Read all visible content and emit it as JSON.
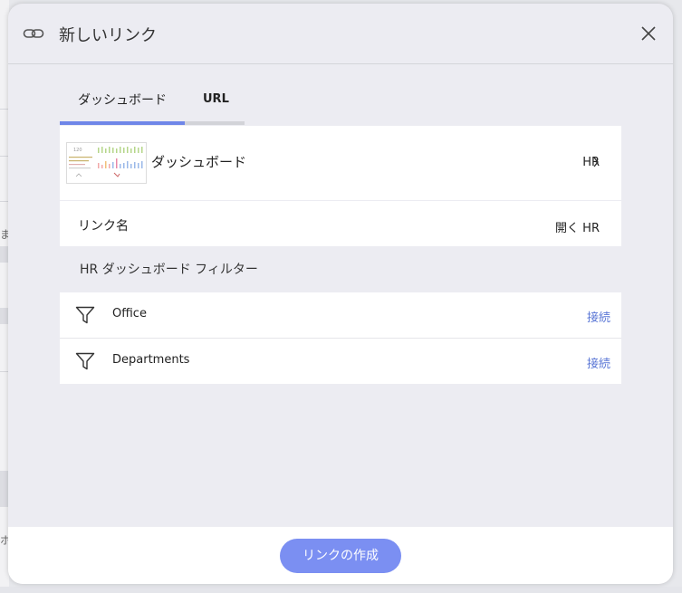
{
  "background": {
    "left_glyph_1": "ま",
    "left_glyph_2": "ホ"
  },
  "modal": {
    "title": "新しいリンク",
    "tabs": [
      {
        "label": "ダッシュボード",
        "active": true
      },
      {
        "label": "URL",
        "active": false
      }
    ],
    "dashboard_card": {
      "name": "ダッシュボード",
      "target": "HR",
      "thumbnail_label": "120"
    },
    "link_name": {
      "label": "リンク名",
      "value": "開く HR"
    },
    "filters_section_title": "HR ダッシュボード フィルター",
    "filters": [
      {
        "name": "Office",
        "action": "接続"
      },
      {
        "name": "Departments",
        "action": "接続"
      }
    ],
    "create_button": "リンクの作成"
  },
  "colors": {
    "accent": "#6f86e8",
    "button": "#7b8ff2",
    "link": "#5b77d6",
    "modal_bg": "#ececf2"
  }
}
